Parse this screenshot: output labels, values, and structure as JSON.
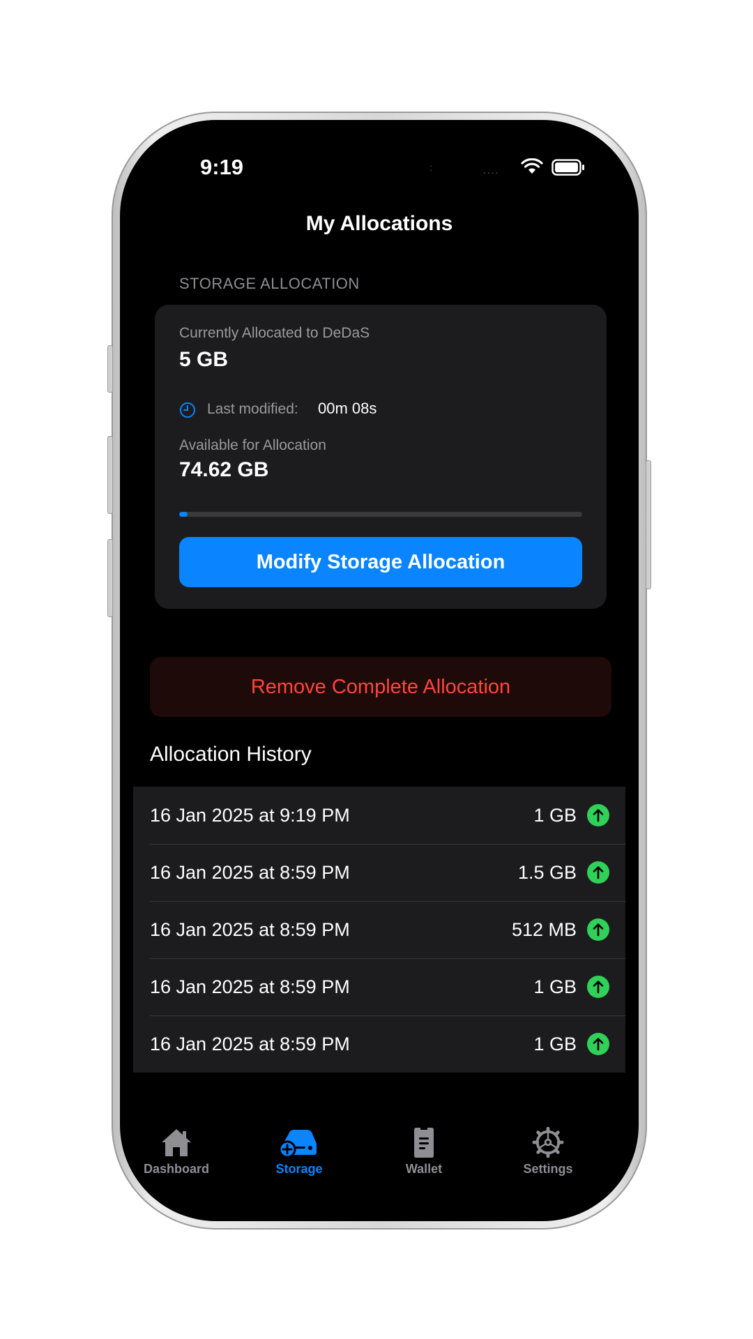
{
  "status_bar": {
    "time": "9:19",
    "signal": "....",
    "island_dot": ":"
  },
  "header": {
    "title": "My Allocations"
  },
  "storage": {
    "section_label": "STORAGE ALLOCATION",
    "allocated_label": "Currently Allocated to DeDaS",
    "allocated_value": "5 GB",
    "last_modified_label": "Last modified:",
    "last_modified_value": "00m 08s",
    "available_label": "Available for Allocation",
    "available_value": "74.62 GB",
    "allocation_fraction": 0.02,
    "modify_button": "Modify Storage Allocation"
  },
  "remove_button": "Remove Complete Allocation",
  "history": {
    "title": "Allocation History",
    "items": [
      {
        "date": "16 Jan 2025 at 9:19 PM",
        "size": "1 GB",
        "icon": "arrow-up-circle-icon"
      },
      {
        "date": "16 Jan 2025 at 8:59 PM",
        "size": "1.5 GB",
        "icon": "arrow-up-circle-icon"
      },
      {
        "date": "16 Jan 2025 at 8:59 PM",
        "size": "512 MB",
        "icon": "arrow-up-circle-icon"
      },
      {
        "date": "16 Jan 2025 at 8:59 PM",
        "size": "1 GB",
        "icon": "arrow-up-circle-icon"
      },
      {
        "date": "16 Jan 2025 at 8:59 PM",
        "size": "1 GB",
        "icon": "arrow-up-circle-icon"
      }
    ]
  },
  "tabbar": {
    "tabs": [
      {
        "label": "Dashboard",
        "icon": "house-icon",
        "active": false
      },
      {
        "label": "Storage",
        "icon": "storage-icon",
        "active": true
      },
      {
        "label": "Wallet",
        "icon": "wallet-icon",
        "active": false
      },
      {
        "label": "Settings",
        "icon": "gear-icon",
        "active": false
      }
    ]
  },
  "colors": {
    "accent": "#0a84ff",
    "danger": "#ff453a",
    "success": "#30d158",
    "card": "#1c1c1e",
    "background": "#000000"
  }
}
